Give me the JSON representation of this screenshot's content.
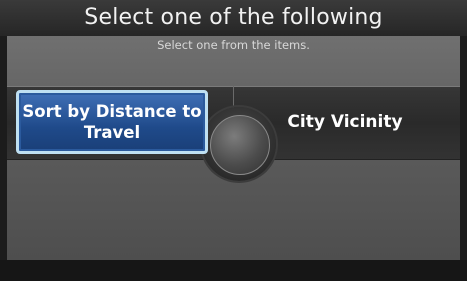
{
  "header": {
    "title": "Select one of the following"
  },
  "main": {
    "subtitle": "Select one from the items.",
    "options": [
      {
        "label": "Sort by Distance to Travel",
        "selected": true
      },
      {
        "label": "City Vicinity",
        "selected": false
      }
    ]
  },
  "colors": {
    "selected_bg": "#1f4a8a",
    "selected_border": "#bfe0f2",
    "header_bg": "#2e2e2e"
  }
}
